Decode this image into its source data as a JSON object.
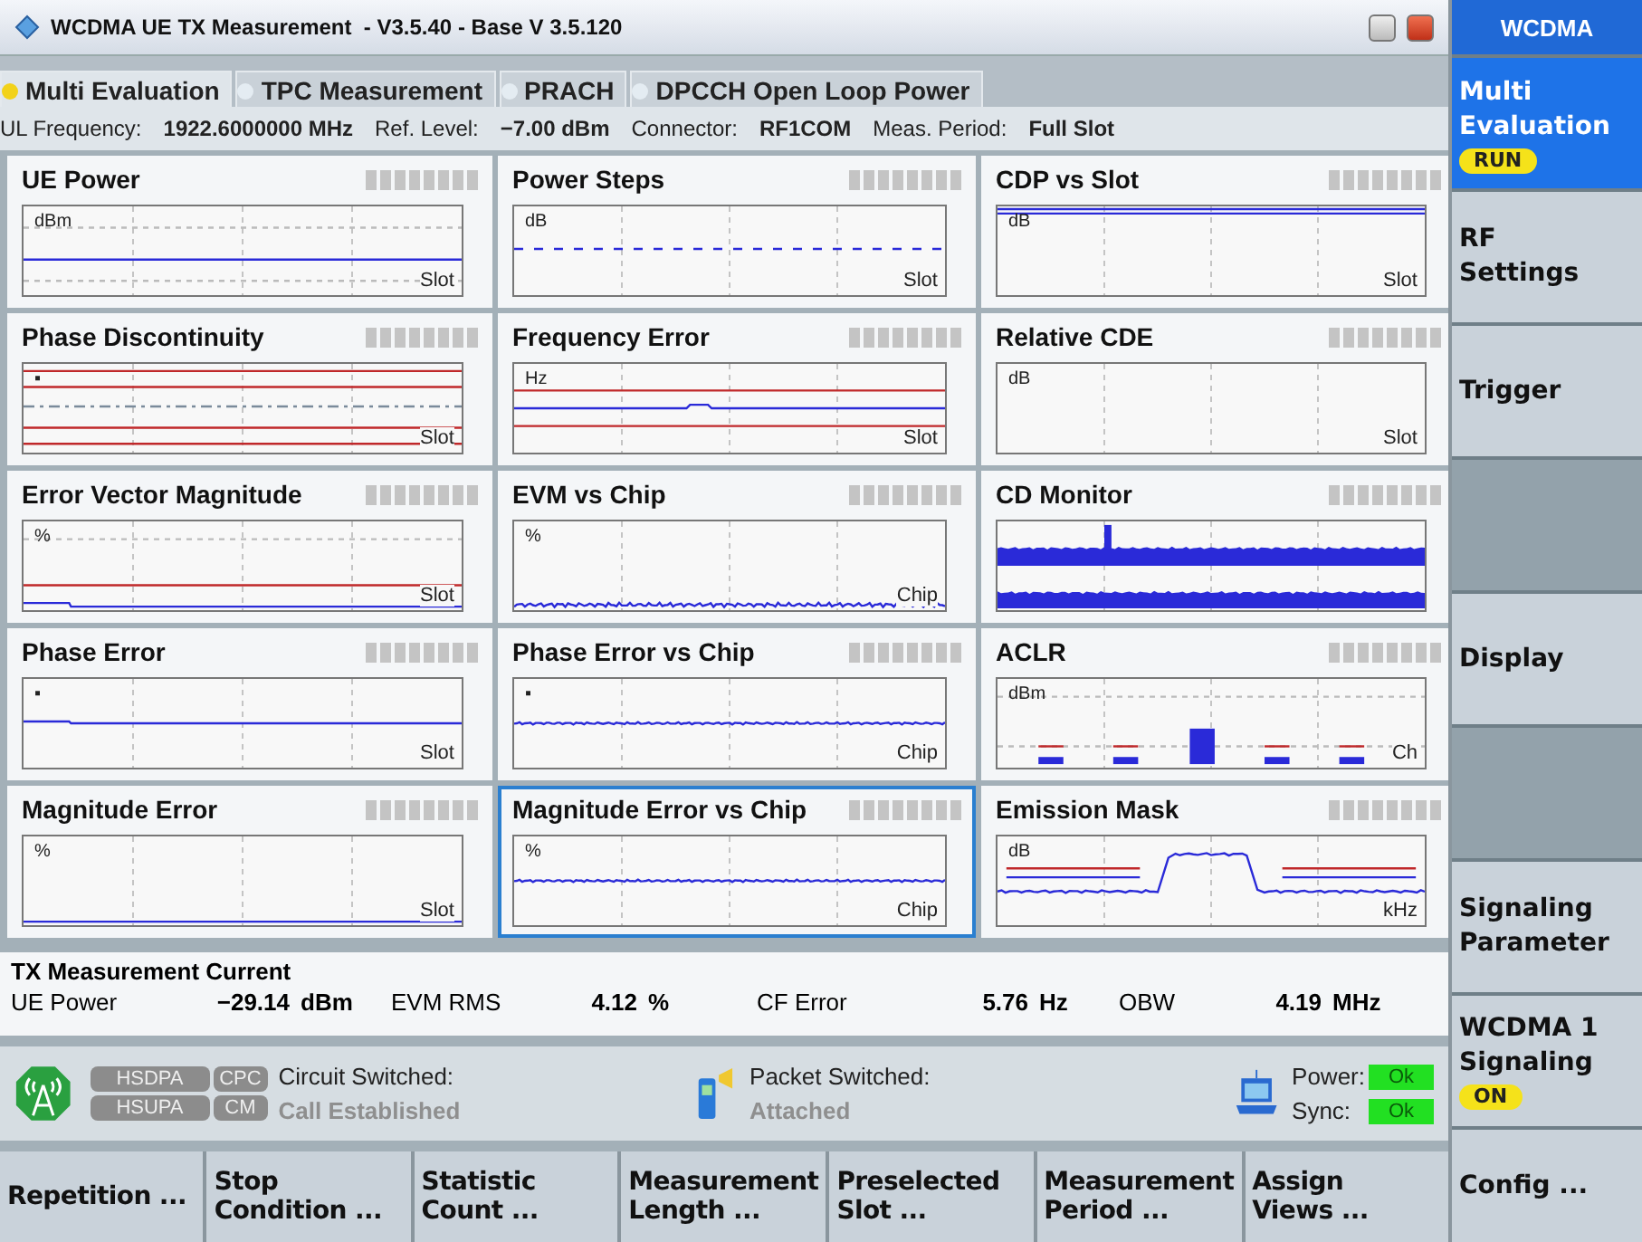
{
  "window": {
    "title": "WCDMA UE TX Measurement  - V3.5.40 - Base V 3.5.120"
  },
  "tabs": [
    {
      "label": "Multi Evaluation",
      "selected": true
    },
    {
      "label": "TPC Measurement",
      "selected": false
    },
    {
      "label": "PRACH",
      "selected": false
    },
    {
      "label": "DPCCH Open Loop Power",
      "selected": false
    }
  ],
  "info_bar": [
    {
      "label": "UL Frequency:",
      "value": "1922.6000000 MHz"
    },
    {
      "label": "Ref. Level:",
      "value": "−7.00 dBm"
    },
    {
      "label": "Connector:",
      "value": "RF1COM"
    },
    {
      "label": "Meas. Period:",
      "value": "Full Slot"
    }
  ],
  "panels": [
    {
      "title": "UE Power",
      "unit": "dBm",
      "axis": "Slot",
      "kind": "level",
      "selected": false
    },
    {
      "title": "Power Steps",
      "unit": "dB",
      "axis": "Slot",
      "kind": "steps",
      "selected": false
    },
    {
      "title": "CDP vs Slot",
      "unit": "dB",
      "axis": "Slot",
      "kind": "top-line",
      "selected": false
    },
    {
      "title": "Phase Discontinuity",
      "unit": "▪",
      "axis": "Slot",
      "kind": "limits",
      "selected": false
    },
    {
      "title": "Frequency Error",
      "unit": "Hz",
      "axis": "Slot",
      "kind": "limits-bump",
      "selected": false
    },
    {
      "title": "Relative CDE",
      "unit": "dB",
      "axis": "Slot",
      "kind": "empty",
      "selected": false
    },
    {
      "title": "Error Vector Magnitude",
      "unit": "%",
      "axis": "Slot",
      "kind": "evm",
      "selected": false
    },
    {
      "title": "EVM vs Chip",
      "unit": "%",
      "axis": "Chip",
      "kind": "noise-bottom",
      "selected": false
    },
    {
      "title": "CD Monitor",
      "kind": "cd-monitor",
      "selected": false
    },
    {
      "title": "Phase Error",
      "unit": "▪",
      "axis": "Slot",
      "kind": "flat",
      "selected": false
    },
    {
      "title": "Phase Error vs Chip",
      "unit": "▪",
      "axis": "Chip",
      "kind": "noise-mid",
      "selected": false
    },
    {
      "title": "ACLR",
      "unit": "dBm",
      "axis": "Ch",
      "kind": "aclr",
      "selected": false
    },
    {
      "title": "Magnitude Error",
      "unit": "%",
      "axis": "Slot",
      "kind": "baseline",
      "selected": false
    },
    {
      "title": "Magnitude Error vs Chip",
      "unit": "%",
      "axis": "Chip",
      "kind": "noise-mid",
      "selected": true
    },
    {
      "title": "Emission Mask",
      "unit": "dB",
      "axis": "kHz",
      "kind": "emission",
      "selected": false
    }
  ],
  "results": {
    "title": "TX Measurement Current",
    "items": [
      {
        "label": "UE Power",
        "value": "−29.14",
        "unit": "dBm"
      },
      {
        "label": "EVM RMS",
        "value": "4.12",
        "unit": "%"
      },
      {
        "label": "CF Error",
        "value": "5.76",
        "unit": "Hz"
      },
      {
        "label": "OBW",
        "value": "4.19",
        "unit": "MHz"
      }
    ]
  },
  "status": {
    "badges": [
      {
        "label": "HSDPA"
      },
      {
        "label": "CPC"
      },
      {
        "label": "HSUPA"
      },
      {
        "label": "CM"
      }
    ],
    "circuit": {
      "label": "Circuit Switched:",
      "state": "Call Established"
    },
    "packet": {
      "label": "Packet Switched:",
      "state": "Attached"
    },
    "indicators": [
      {
        "label": "Power:",
        "value": "Ok",
        "ok": true
      },
      {
        "label": "Sync:",
        "value": "Ok",
        "ok": true
      }
    ]
  },
  "softkeys": [
    "Repetition ...",
    "Stop\nCondition ...",
    "Statistic\nCount ...",
    "Measurement\nLength ...",
    "Preselected\nSlot ...",
    "Measurement\nPeriod ...",
    "Assign\nViews ..."
  ],
  "sidebar": {
    "header": "WCDMA",
    "items": [
      {
        "kind": "key",
        "label": "Multi\nEvaluation",
        "selected": true,
        "badge": "RUN"
      },
      {
        "kind": "key",
        "label": "RF\nSettings",
        "selected": false
      },
      {
        "kind": "key",
        "label": "Trigger",
        "selected": false
      },
      {
        "kind": "blank"
      },
      {
        "kind": "key",
        "label": "Display",
        "selected": false
      },
      {
        "kind": "blank"
      },
      {
        "kind": "key",
        "label": "Signaling\nParameter",
        "selected": false
      },
      {
        "kind": "key",
        "label": "WCDMA 1\nSignaling",
        "selected": false,
        "badge": "ON"
      }
    ],
    "bottom_key": "Config ..."
  }
}
